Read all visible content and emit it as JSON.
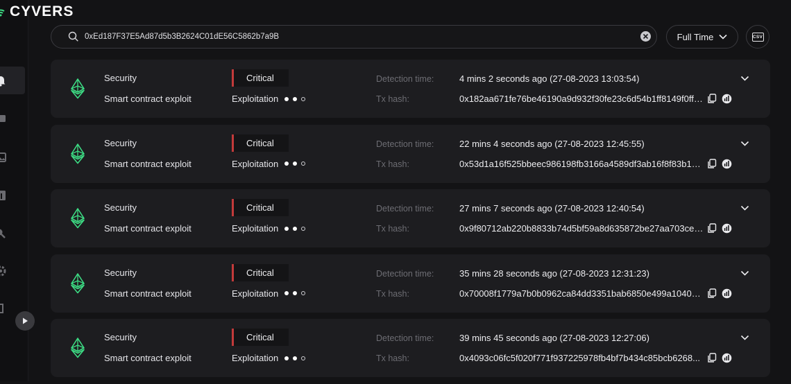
{
  "brand": {
    "name": "CYVERS",
    "accent": "#3ddc84"
  },
  "search": {
    "value": "0xEd187F37E5Ad87d5b3B2624C01dE56C5862b7a9B"
  },
  "filters": {
    "time_range": "Full Time",
    "export_label": "CSV"
  },
  "colors": {
    "severity_critical": "#c23a3a",
    "eth_icon": "#3ddc84"
  },
  "labels": {
    "detection_time": "Detection time:",
    "tx_hash": "Tx hash:"
  },
  "alerts": [
    {
      "chain_icon": "ethereum-icon",
      "category": "Security",
      "type": "Smart contract exploit",
      "severity": "Critical",
      "stage": "Exploitation",
      "stage_progress": "2 of 3",
      "detection_time": "4 mins 2 seconds ago (27-08-2023 13:03:54)",
      "tx_hash": "0x182aa671fe76be46190a9d932f30fe23c6d54b1ff8149f0ff6..."
    },
    {
      "chain_icon": "ethereum-icon",
      "category": "Security",
      "type": "Smart contract exploit",
      "severity": "Critical",
      "stage": "Exploitation",
      "stage_progress": "2 of 3",
      "detection_time": "22 mins 4 seconds ago (27-08-2023 12:45:55)",
      "tx_hash": "0x53d1a16f525bbeec986198fb3166a4589df3ab16f8f83b18d5..."
    },
    {
      "chain_icon": "ethereum-icon",
      "category": "Security",
      "type": "Smart contract exploit",
      "severity": "Critical",
      "stage": "Exploitation",
      "stage_progress": "2 of 3",
      "detection_time": "27 mins 7 seconds ago (27-08-2023 12:40:54)",
      "tx_hash": "0x9f80712ab220b8833b74d5bf59a8d635872be27aa703ce2..."
    },
    {
      "chain_icon": "ethereum-icon",
      "category": "Security",
      "type": "Smart contract exploit",
      "severity": "Critical",
      "stage": "Exploitation",
      "stage_progress": "2 of 3",
      "detection_time": "35 mins 28 seconds ago (27-08-2023 12:31:23)",
      "tx_hash": "0x70008f1779a7b0b0962ca84dd3351bab6850e499a10408..."
    },
    {
      "chain_icon": "ethereum-icon",
      "category": "Security",
      "type": "Smart contract exploit",
      "severity": "Critical",
      "stage": "Exploitation",
      "stage_progress": "2 of 3",
      "detection_time": "39 mins 45 seconds ago (27-08-2023 12:27:06)",
      "tx_hash": "0x4093c06fc5f020f771f937225978fb4bf7b434c85bcb6268..."
    }
  ]
}
